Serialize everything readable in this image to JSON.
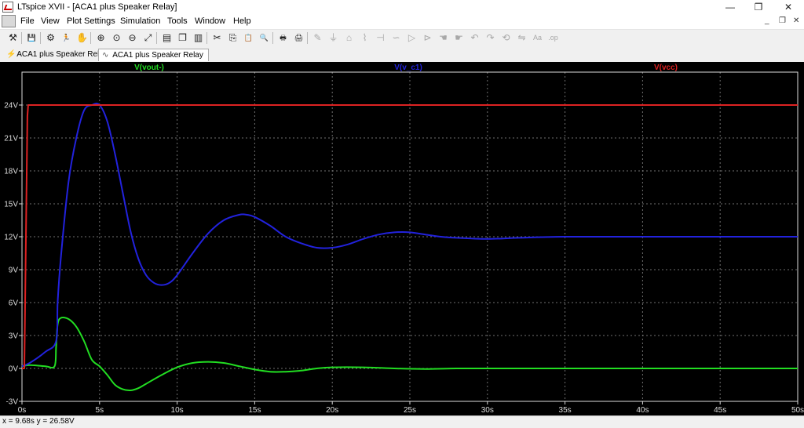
{
  "window": {
    "title": "LTspice XVII - [ACA1 plus Speaker Relay]",
    "minimize_glyph": "—",
    "restore_glyph": "❐",
    "close_glyph": "✕"
  },
  "menu": {
    "items": [
      "File",
      "View",
      "Plot Settings",
      "Simulation",
      "Tools",
      "Window",
      "Help"
    ],
    "mdi_min": "_",
    "mdi_restore": "❐",
    "mdi_close": "✕"
  },
  "toolbar": {
    "buttons": [
      {
        "icon": "schematic-hammer-icon",
        "glyph": "⚒"
      },
      {
        "icon": "save-icon",
        "glyph": "💾"
      },
      {
        "icon": "control-panel-icon",
        "glyph": "⚙"
      },
      {
        "icon": "run-icon",
        "glyph": "🏃"
      },
      {
        "icon": "pan-hand-icon",
        "glyph": "✋"
      },
      {
        "icon": "zoom-in-icon",
        "glyph": "⊕"
      },
      {
        "icon": "zoom-fit-icon",
        "glyph": "⊙"
      },
      {
        "icon": "zoom-out-icon",
        "glyph": "⊖"
      },
      {
        "icon": "autoscale-icon",
        "glyph": "⤢"
      },
      {
        "icon": "tile-horizontal-icon",
        "glyph": "▤"
      },
      {
        "icon": "cascade-icon",
        "glyph": "❐"
      },
      {
        "icon": "tile-vertical-icon",
        "glyph": "▥"
      },
      {
        "icon": "cut-icon",
        "glyph": "✂"
      },
      {
        "icon": "copy-icon",
        "glyph": "⎘"
      },
      {
        "icon": "paste-icon",
        "glyph": "📋"
      },
      {
        "icon": "find-icon",
        "glyph": "🔍"
      },
      {
        "icon": "print-icon",
        "glyph": "🖶"
      },
      {
        "icon": "print-setup-icon",
        "glyph": "🖨"
      },
      {
        "icon": "pencil-icon",
        "glyph": "✎"
      },
      {
        "icon": "ground-icon",
        "glyph": "⏚"
      },
      {
        "icon": "label-icon",
        "glyph": "⌂"
      },
      {
        "icon": "resistor-icon",
        "glyph": "⌇"
      },
      {
        "icon": "capacitor-icon",
        "glyph": "⊣"
      },
      {
        "icon": "inductor-icon",
        "glyph": "∽"
      },
      {
        "icon": "diode-icon",
        "glyph": "▷"
      },
      {
        "icon": "component-icon",
        "glyph": "⊳"
      },
      {
        "icon": "move-hand-icon",
        "glyph": "☚"
      },
      {
        "icon": "drag-hand-icon",
        "glyph": "☛"
      },
      {
        "icon": "undo-icon",
        "glyph": "↶"
      },
      {
        "icon": "redo-icon",
        "glyph": "↷"
      },
      {
        "icon": "rotate-icon",
        "glyph": "⟲"
      },
      {
        "icon": "mirror-icon",
        "glyph": "⇋"
      },
      {
        "icon": "text-icon",
        "glyph": "Aa"
      },
      {
        "icon": "spice-directive-icon",
        "glyph": ".op"
      }
    ]
  },
  "tabs": [
    {
      "label": "ACA1 plus Speaker Relay",
      "icon": "schematic-icon",
      "glyph": "⚡",
      "active": false
    },
    {
      "label": "ACA1 plus Speaker Relay",
      "icon": "waveform-icon",
      "glyph": "∿",
      "active": true
    }
  ],
  "colors": {
    "trace_vout": "#22dd22",
    "trace_vc1": "#2222dd",
    "trace_vcc": "#dd2222",
    "axis": "#dddddd",
    "grid": "#707070",
    "plot_bg": "#000000"
  },
  "chart_data": {
    "type": "line",
    "xlim": [
      0,
      50
    ],
    "ylim": [
      -3,
      27
    ],
    "x_ticks": [
      {
        "v": 0,
        "label": "0s"
      },
      {
        "v": 5,
        "label": "5s"
      },
      {
        "v": 10,
        "label": "10s"
      },
      {
        "v": 15,
        "label": "15s"
      },
      {
        "v": 20,
        "label": "20s"
      },
      {
        "v": 25,
        "label": "25s"
      },
      {
        "v": 30,
        "label": "30s"
      },
      {
        "v": 35,
        "label": "35s"
      },
      {
        "v": 40,
        "label": "40s"
      },
      {
        "v": 45,
        "label": "45s"
      },
      {
        "v": 50,
        "label": "50s"
      }
    ],
    "y_ticks": [
      {
        "v": -3,
        "label": "-3V"
      },
      {
        "v": 0,
        "label": "0V"
      },
      {
        "v": 3,
        "label": "3V"
      },
      {
        "v": 6,
        "label": "6V"
      },
      {
        "v": 9,
        "label": "9V"
      },
      {
        "v": 12,
        "label": "12V"
      },
      {
        "v": 15,
        "label": "15V"
      },
      {
        "v": 18,
        "label": "18V"
      },
      {
        "v": 21,
        "label": "21V"
      },
      {
        "v": 24,
        "label": "24V"
      }
    ],
    "grid": true,
    "series": [
      {
        "name": "V(vout-)",
        "color": "#22dd22",
        "x": [
          0,
          0.5,
          1.5,
          2.1,
          2.2,
          2.3,
          2.5,
          3.0,
          3.5,
          4.0,
          4.5,
          5.0,
          5.5,
          6.0,
          6.5,
          7.0,
          7.5,
          8.0,
          9.0,
          10.0,
          11.0,
          12.0,
          13.0,
          14.0,
          15.0,
          16.0,
          17.0,
          18.0,
          19.0,
          20.0,
          22.0,
          24.0,
          26.0,
          28.0,
          30.0,
          35.0,
          40.0,
          45.0,
          50.0
        ],
        "y": [
          0.2,
          0.3,
          0.2,
          0.2,
          2.0,
          4.0,
          4.6,
          4.5,
          3.8,
          2.5,
          0.8,
          0.2,
          -0.6,
          -1.5,
          -1.9,
          -2.0,
          -1.8,
          -1.4,
          -0.6,
          0.1,
          0.5,
          0.6,
          0.5,
          0.2,
          -0.1,
          -0.3,
          -0.3,
          -0.2,
          0.0,
          0.1,
          0.1,
          0.0,
          -0.05,
          0.0,
          0.0,
          0.0,
          0.0,
          0.0,
          0.0
        ]
      },
      {
        "name": "V(v_c1)",
        "color": "#2222dd",
        "x": [
          0,
          0.5,
          1.5,
          2.2,
          2.3,
          2.5,
          3.0,
          3.5,
          4.0,
          4.5,
          5.0,
          5.5,
          6.0,
          6.5,
          7.0,
          7.5,
          8.0,
          8.5,
          9.0,
          9.5,
          10.0,
          11.0,
          12.0,
          13.0,
          14.0,
          14.5,
          15.0,
          16.0,
          17.0,
          18.0,
          19.0,
          20.0,
          21.0,
          22.0,
          23.0,
          24.0,
          25.0,
          26.0,
          27.0,
          28.0,
          30.0,
          32.0,
          35.0,
          40.0,
          45.0,
          50.0
        ],
        "y": [
          0.2,
          0.5,
          1.5,
          2.5,
          6.0,
          10.0,
          17.0,
          21.0,
          23.5,
          24.0,
          24.0,
          22.5,
          19.5,
          16.0,
          12.5,
          10.0,
          8.5,
          7.8,
          7.6,
          7.8,
          8.5,
          10.5,
          12.3,
          13.5,
          14.0,
          14.0,
          13.8,
          13.0,
          12.0,
          11.4,
          11.0,
          11.0,
          11.3,
          11.8,
          12.2,
          12.4,
          12.4,
          12.2,
          12.0,
          11.9,
          11.8,
          11.9,
          12.0,
          12.0,
          12.0,
          12.0
        ]
      },
      {
        "name": "V(vcc)",
        "color": "#dd2222",
        "x": [
          0,
          0.15,
          0.35,
          0.4,
          50
        ],
        "y": [
          0,
          0,
          23,
          24,
          24
        ]
      }
    ]
  },
  "status": {
    "cursor_readout": "x = 9.68s   y = 26.58V"
  }
}
